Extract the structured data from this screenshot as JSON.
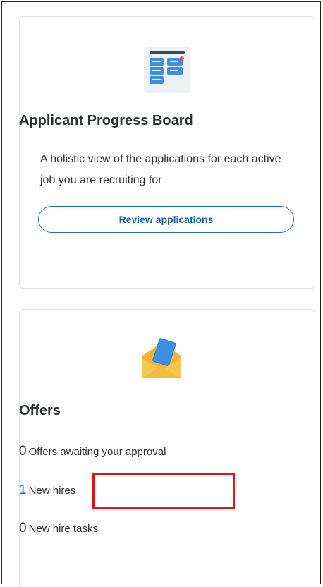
{
  "applicant_progress_board": {
    "icon": "kanban-board-icon",
    "title": "Applicant Progress Board",
    "description": "A holistic view of the applications for each active job you are recruiting for",
    "button_label": "Review applications"
  },
  "offers": {
    "icon": "envelope-offer-icon",
    "title": "Offers",
    "stats": [
      {
        "count": "0",
        "label": "Offers awaiting your approval"
      },
      {
        "count": "1",
        "label": "New hires"
      },
      {
        "count": "0",
        "label": "New hire tasks"
      }
    ]
  },
  "colors": {
    "accent": "#1f6fb5",
    "highlight": "#e0141e",
    "card_border": "#dde1e5"
  }
}
